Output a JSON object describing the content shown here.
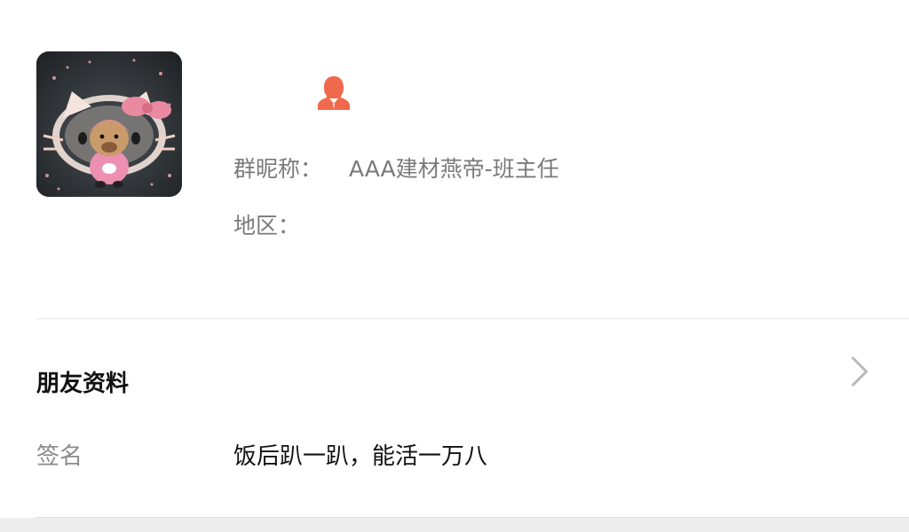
{
  "profile": {
    "avatar_icon": "avatar-photo",
    "gender_icon": "user-silhouette-icon",
    "gender_color": "#f0694d",
    "nickname_label": "群昵称：",
    "nickname_value": "AAA建材燕帝-班主任",
    "region_label": "地区："
  },
  "friend_info": {
    "title": "朋友资料",
    "chevron_icon": "chevron-right-icon",
    "signature_label": "签名",
    "signature_value": "饭后趴一趴，能活一万八"
  }
}
